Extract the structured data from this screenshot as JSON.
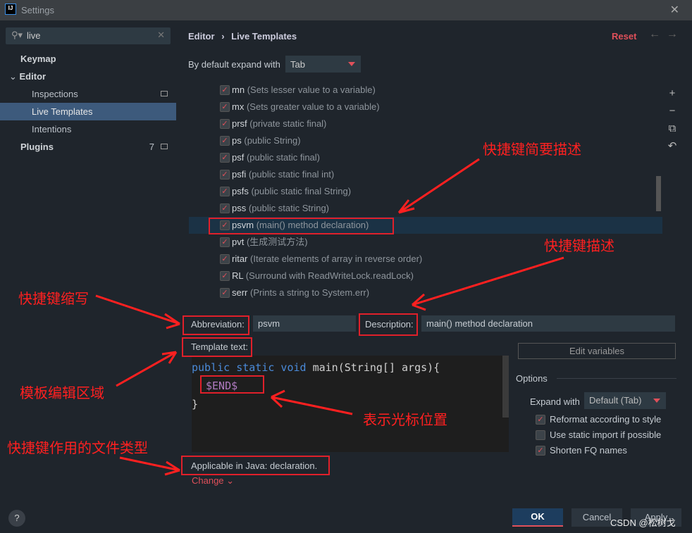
{
  "window": {
    "title": "Settings",
    "app_icon": "IJ"
  },
  "sidebar": {
    "search_value": "live",
    "items": [
      {
        "label": "Keymap"
      },
      {
        "label": "Editor"
      },
      {
        "label": "Inspections"
      },
      {
        "label": "Live Templates"
      },
      {
        "label": "Intentions"
      },
      {
        "label": "Plugins",
        "count": "7"
      }
    ]
  },
  "header": {
    "breadcrumb_parent": "Editor",
    "breadcrumb_sep": "›",
    "breadcrumb_current": "Live Templates",
    "reset": "Reset"
  },
  "expand": {
    "label": "By default expand with",
    "value": "Tab"
  },
  "templates": [
    {
      "abbr": "mn",
      "desc": "(Sets lesser value to a variable)",
      "checked": true
    },
    {
      "abbr": "mx",
      "desc": "(Sets greater value to a variable)",
      "checked": true
    },
    {
      "abbr": "prsf",
      "desc": "(private static final)",
      "checked": true
    },
    {
      "abbr": "ps",
      "desc": "(public String)",
      "checked": true
    },
    {
      "abbr": "psf",
      "desc": "(public static final)",
      "checked": true
    },
    {
      "abbr": "psfi",
      "desc": "(public static final int)",
      "checked": true
    },
    {
      "abbr": "psfs",
      "desc": "(public static final String)",
      "checked": true
    },
    {
      "abbr": "pss",
      "desc": "(public static String)",
      "checked": true
    },
    {
      "abbr": "psvm",
      "desc": "(main() method declaration)",
      "checked": true,
      "selected": true
    },
    {
      "abbr": "pvt",
      "desc": "(生成测试方法)",
      "checked": true
    },
    {
      "abbr": "ritar",
      "desc": "(Iterate elements of array in reverse order)",
      "checked": true
    },
    {
      "abbr": "RL",
      "desc": "(Surround with ReadWriteLock.readLock)",
      "checked": true
    },
    {
      "abbr": "serr",
      "desc": "(Prints a string to System.err)",
      "checked": true
    }
  ],
  "detail": {
    "abbr_label": "Abbreviation:",
    "abbr_value": "psvm",
    "desc_label": "Description:",
    "desc_value": "main() method declaration",
    "template_label": "Template text:",
    "code": {
      "kw": "public static void",
      "rest": " main(String[] args){",
      "end": "$END$",
      "close": "}"
    },
    "edit_variables": "Edit variables",
    "applicable": "Applicable in Java: declaration.",
    "change": "Change"
  },
  "options": {
    "title": "Options",
    "expand_label": "Expand with",
    "expand_value": "Default (Tab)",
    "checks": [
      {
        "label": "Reformat according to style",
        "checked": true
      },
      {
        "label": "Use static import if possible",
        "checked": false
      },
      {
        "label": "Shorten FQ names",
        "checked": true
      }
    ]
  },
  "buttons": {
    "ok": "OK",
    "cancel": "Cancel",
    "apply": "Apply",
    "help": "?"
  },
  "annotations": {
    "shortcut_brief": "快捷键简要描述",
    "shortcut_desc": "快捷键描述",
    "shortcut_abbr": "快捷键缩写",
    "template_area": "模板编辑区域",
    "cursor_pos": "表示光标位置",
    "file_type": "快捷键作用的文件类型"
  },
  "watermark": "CSDN @松树戈",
  "colors": {
    "accent": "#e0505a",
    "selection": "#3d5a7c",
    "annotation": "#ff2020"
  }
}
